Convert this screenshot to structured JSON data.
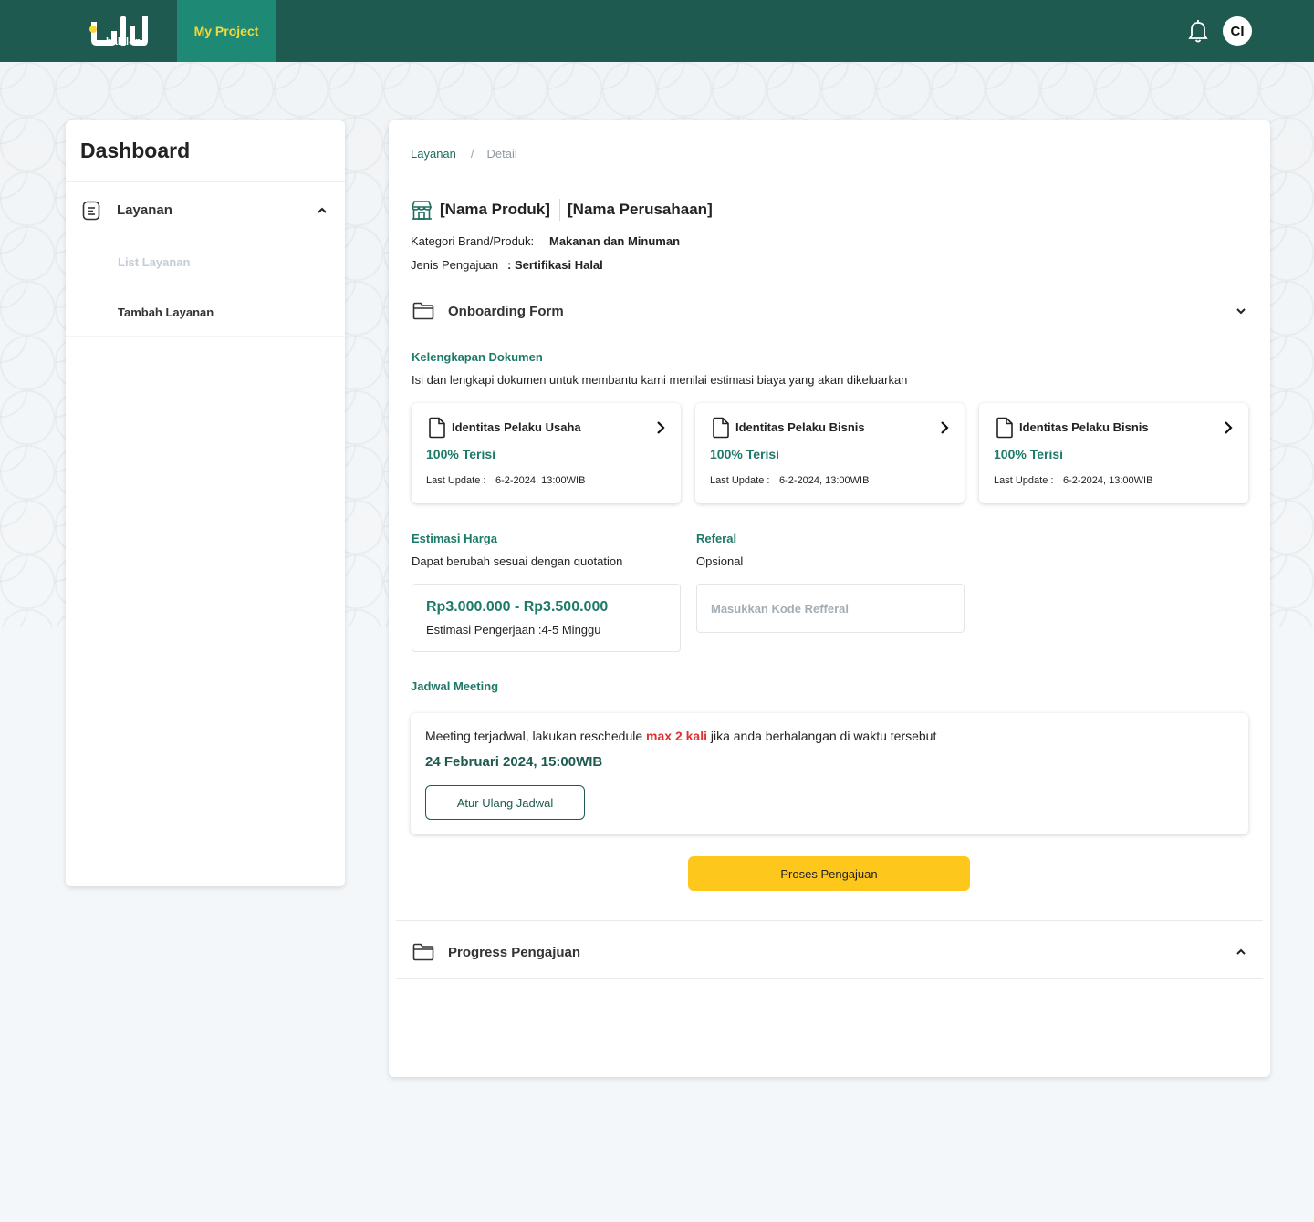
{
  "topbar": {
    "logo_text": "halal-in",
    "nav_tab": "My Project",
    "avatar_initials": "CI"
  },
  "sidebar": {
    "title": "Dashboard",
    "section_label": "Layanan",
    "sub_items": [
      "List Layanan",
      "Tambah Layanan"
    ]
  },
  "breadcrumb": {
    "parent": "Layanan",
    "separator": "/",
    "current": "Detail"
  },
  "product": {
    "name": "[Nama Produk]",
    "company": "[Nama Perusahaan]",
    "category_label": "Kategori Brand/Produk:",
    "category_value": "Makanan dan Minuman",
    "type_label": "Jenis Pengajuan",
    "type_value": ": Sertifikasi Halal"
  },
  "onboarding": {
    "title": "Onboarding Form",
    "docs_title": "Kelengkapan Dokumen",
    "docs_desc": "Isi dan lengkapi dokumen untuk membantu kami menilai estimasi biaya yang akan dikeluarkan",
    "docs": [
      {
        "title": "Identitas Pelaku Usaha",
        "status": "100% Terisi",
        "update_label": "Last Update :",
        "update_value": "6-2-2024, 13:00WIB"
      },
      {
        "title": "Identitas Pelaku Bisnis",
        "status": "100% Terisi",
        "update_label": "Last Update :",
        "update_value": "6-2-2024, 13:00WIB"
      },
      {
        "title": "Identitas Pelaku Bisnis",
        "status": "100% Terisi",
        "update_label": "Last Update :",
        "update_value": "6-2-2024, 13:00WIB"
      }
    ],
    "price": {
      "title": "Estimasi Harga",
      "desc": "Dapat berubah sesuai dengan quotation",
      "range": "Rp3.000.000 - Rp3.500.000",
      "duration": "Estimasi Pengerjaan :4-5 Minggu"
    },
    "referral": {
      "title": "Referal",
      "desc": "Opsional",
      "placeholder": "Masukkan Kode Refferal",
      "value": ""
    },
    "meeting": {
      "title": "Jadwal Meeting",
      "text_before": "Meeting terjadwal, lakukan reschedule ",
      "text_highlight": "max 2 kali",
      "text_after": " jika anda berhalangan di waktu tersebut",
      "date": "24 Februari 2024, 15:00WIB",
      "button": "Atur Ulang Jadwal"
    },
    "submit_button": "Proses Pengajuan"
  },
  "progress": {
    "title": "Progress Pengajuan"
  },
  "colors": {
    "topbar": "#1e5a50",
    "nav_active": "#1e8a76",
    "nav_text": "#f4d83a",
    "accent_green": "#1e7a68",
    "highlight_red": "#e0312f",
    "submit_yellow": "#fdc71c"
  }
}
